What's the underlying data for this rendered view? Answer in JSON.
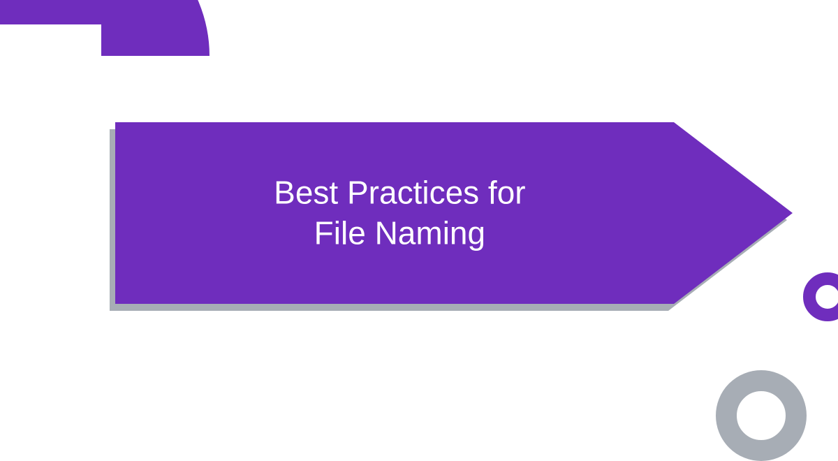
{
  "title": "Best Practices for\nFile Naming",
  "colors": {
    "primary": "#6f2dbd",
    "shadow": "#a7adb5",
    "gray": "#a7adb5"
  }
}
